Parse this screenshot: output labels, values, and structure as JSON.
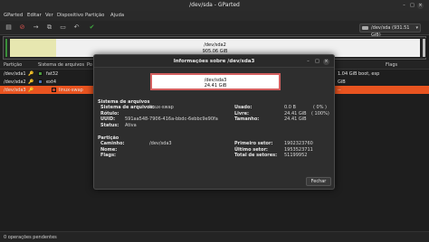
{
  "window": {
    "title": "/dev/sda - GParted"
  },
  "menu": [
    "GParted",
    "Editar",
    "Ver",
    "Dispositivo",
    "Partição",
    "Ajuda"
  ],
  "device_selector": {
    "value": "/dev/sda (931.51 GiB)"
  },
  "diskmap": {
    "main_name": "/dev/sda2",
    "main_size": "905.06 GiB",
    "used_color": "#e7e7b0"
  },
  "list": {
    "headers": {
      "partition": "Partição",
      "filesystem": "Sistema de arquivos",
      "mount": "Po",
      "size_tail": "1.04 GiB",
      "flags": "Flags"
    },
    "rows": [
      {
        "partition": "/dev/sda1",
        "fs": "fat32",
        "fs_color": "#4d9a3e",
        "used_tail": "GiB",
        "flags": "boot, esp"
      },
      {
        "partition": "/dev/sda2",
        "fs": "ext4",
        "fs_color": "#4a73b5",
        "used_tail": "GiB",
        "flags": ""
      },
      {
        "partition": "/dev/sda3",
        "fs": "linux-swap",
        "fs_color": "#c1442e",
        "used_tail": "--",
        "flags": ""
      }
    ]
  },
  "status": {
    "pending": "0 operações pendentes"
  },
  "dialog": {
    "title": "Informações sobre /dev/sda3",
    "box_name": "/dev/sda3",
    "box_size": "24.41 GiB",
    "section_fs": "Sistema de arquivos",
    "fs_label_label": "Sistema de arquivos:",
    "fs_label_value": "linux-swap",
    "rotulo_label": "Rótulo:",
    "uuid_label": "UUID:",
    "uuid_value": "591aa548-7906-416a-bbdc-6ebbc9e90fa",
    "status_label": "Status:",
    "status_value": "Ativa",
    "used_label": "Usado:",
    "used_value": "0.0 B",
    "used_pct": "( 0% )",
    "free_label": "Livre:",
    "free_value": "24.41 GiB",
    "free_pct": "( 100%)",
    "size_label": "Tamanho:",
    "size_value": "24.41 GiB",
    "section_part": "Partição",
    "path_label": "Caminho:",
    "path_value": "/dev/sda3",
    "name_label": "Nome:",
    "flags_label": "Flags:",
    "first_sector_label": "Primeiro setor:",
    "first_sector_value": "1902323760",
    "last_sector_label": "Último setor:",
    "last_sector_value": "1953523711",
    "total_sectors_label": "Total de setores:",
    "total_sectors_value": "51199952",
    "close_label": "Fechar"
  }
}
